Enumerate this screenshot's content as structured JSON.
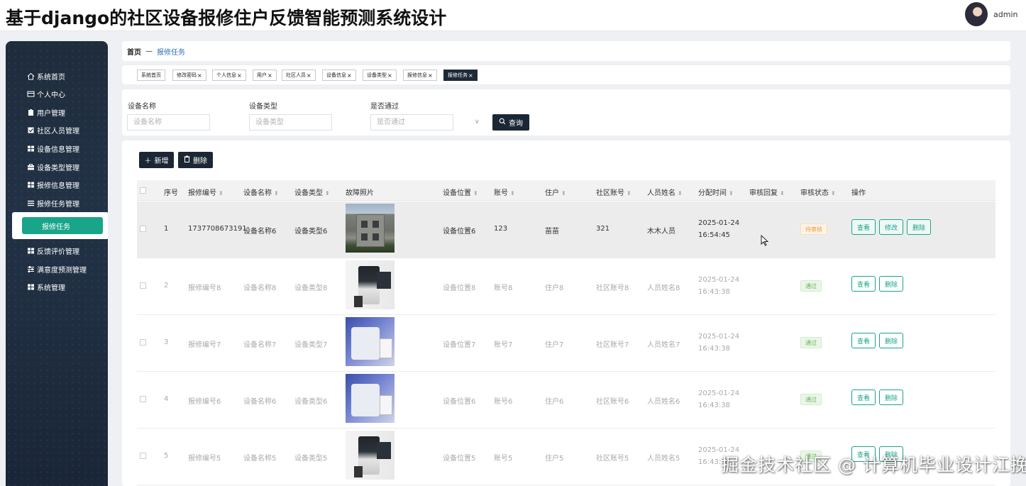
{
  "header": {
    "title": "基于django的社区设备报修住户反馈智能预测系统设计",
    "user": "admin"
  },
  "sidebar": {
    "items": [
      {
        "label": "系统首页",
        "icon": "home-icon"
      },
      {
        "label": "个人中心",
        "icon": "profile-icon"
      },
      {
        "label": "用户管理",
        "icon": "clipboard-icon"
      },
      {
        "label": "社区人员管理",
        "icon": "checkbox-icon"
      },
      {
        "label": "设备信息管理",
        "icon": "grid-icon"
      },
      {
        "label": "设备类型管理",
        "icon": "briefcase-icon"
      },
      {
        "label": "报修信息管理",
        "icon": "grid-icon"
      },
      {
        "label": "报修任务管理",
        "icon": "list-icon"
      },
      {
        "label": "报修任务",
        "icon": "",
        "active": true
      },
      {
        "label": "反馈评价管理",
        "icon": "grid-icon"
      },
      {
        "label": "满意度预测管理",
        "icon": "sliders-icon"
      },
      {
        "label": "系统管理",
        "icon": "grid-icon"
      }
    ]
  },
  "breadcrumb": {
    "home": "首页",
    "sep": "—",
    "current": "报修任务"
  },
  "tabs": [
    {
      "label": "系统首页",
      "closable": false
    },
    {
      "label": "修改密码",
      "closable": true
    },
    {
      "label": "个人信息",
      "closable": true
    },
    {
      "label": "用户",
      "closable": true
    },
    {
      "label": "社区人员",
      "closable": true
    },
    {
      "label": "设备信息",
      "closable": true
    },
    {
      "label": "设备类型",
      "closable": true
    },
    {
      "label": "报修信息",
      "closable": true
    },
    {
      "label": "报修任务",
      "closable": true,
      "active": true
    }
  ],
  "search": {
    "fields": [
      {
        "label": "设备名称",
        "placeholder": "设备名称"
      },
      {
        "label": "设备类型",
        "placeholder": "设备类型"
      },
      {
        "label": "是否通过",
        "placeholder": "是否通过"
      }
    ],
    "query_label": "查询"
  },
  "toolbar": {
    "add_label": "新增",
    "delete_label": "删除"
  },
  "table": {
    "columns": [
      "序号",
      "报修编号",
      "设备名称",
      "设备类型",
      "故障照片",
      "设备位置",
      "账号",
      "住户",
      "社区账号",
      "人员姓名",
      "分配时间",
      "审核回复",
      "审核状态",
      "操作"
    ],
    "rows": [
      {
        "no": "1",
        "code": "1737708673191",
        "name": "设备名称6",
        "type": "设备类型6",
        "photo": "building",
        "location": "设备位置6",
        "account": "123",
        "resident": "苗苗",
        "community_account": "321",
        "person": "木木人员",
        "time": "2025-01-24 16:54:45",
        "reply": "",
        "status": "待审核",
        "status_kind": "pending",
        "actions": [
          "查看",
          "修改",
          "删除"
        ]
      },
      {
        "no": "2",
        "code": "报修编号8",
        "name": "设备名称8",
        "type": "设备类型8",
        "photo": "micro1",
        "location": "设备位置8",
        "account": "账号8",
        "resident": "住户8",
        "community_account": "社区账号8",
        "person": "人员姓名8",
        "time": "2025-01-24 16:43:38",
        "reply": "",
        "status": "通过",
        "status_kind": "pass",
        "actions": [
          "查看",
          "删除"
        ]
      },
      {
        "no": "3",
        "code": "报修编号7",
        "name": "设备名称7",
        "type": "设备类型7",
        "photo": "micro2",
        "location": "设备位置7",
        "account": "账号7",
        "resident": "住户7",
        "community_account": "社区账号7",
        "person": "人员姓名7",
        "time": "2025-01-24 16:43:38",
        "reply": "",
        "status": "通过",
        "status_kind": "pass",
        "actions": [
          "查看",
          "删除"
        ]
      },
      {
        "no": "4",
        "code": "报修编号6",
        "name": "设备名称6",
        "type": "设备类型6",
        "photo": "micro2",
        "location": "设备位置6",
        "account": "账号6",
        "resident": "住户6",
        "community_account": "社区账号6",
        "person": "人员姓名6",
        "time": "2025-01-24 16:43:38",
        "reply": "",
        "status": "通过",
        "status_kind": "pass",
        "actions": [
          "查看",
          "删除"
        ]
      },
      {
        "no": "5",
        "code": "报修编号5",
        "name": "设备名称5",
        "type": "设备类型5",
        "photo": "micro1",
        "location": "设备位置5",
        "account": "账号5",
        "resident": "住户5",
        "community_account": "社区账号5",
        "person": "人员姓名5",
        "time": "2025-01-24 16:43:38",
        "reply": "",
        "status": "通过",
        "status_kind": "pass",
        "actions": [
          "查看",
          "删除"
        ]
      }
    ]
  },
  "watermark": "掘金技术社区 @ 计算机毕业设计江挽"
}
